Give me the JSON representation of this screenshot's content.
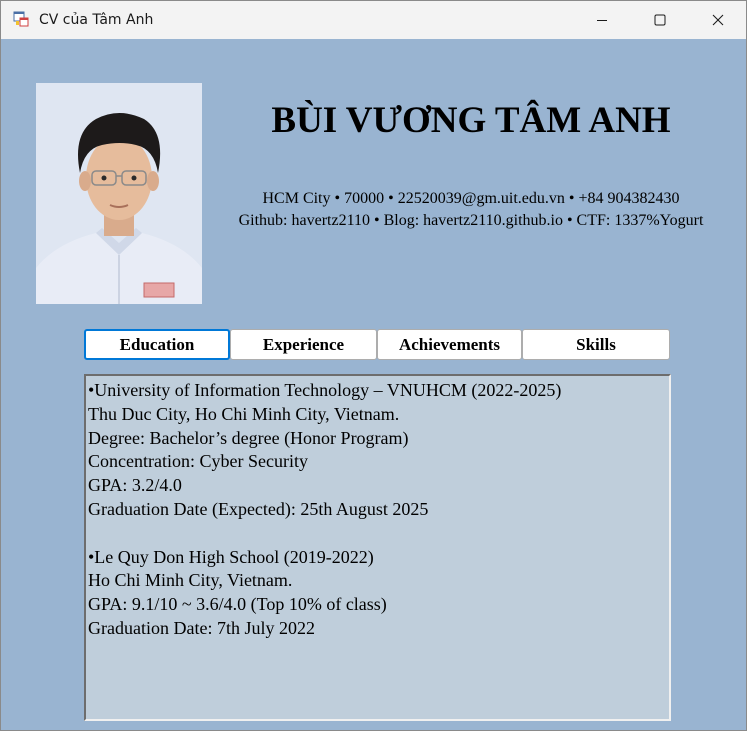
{
  "window": {
    "title": "CV của Tâm Anh"
  },
  "icons": {
    "app": "app-window-icon",
    "minimize": "minimize-icon",
    "maximize": "maximize-icon",
    "close": "close-icon"
  },
  "profile": {
    "name": "BÙI VƯƠNG TÂM ANH",
    "contact_line1": "HCM City • 70000 • 22520039@gm.uit.edu.vn • +84 904382430",
    "contact_line2": "Github: havertz2110 • Blog: havertz2110.github.io • CTF: 1337%Yogurt"
  },
  "tabs": [
    {
      "label": "Education",
      "active": true
    },
    {
      "label": "Experience",
      "active": false
    },
    {
      "label": "Achievements",
      "active": false
    },
    {
      "label": "Skills",
      "active": false
    }
  ],
  "education": {
    "lines": [
      "•University of Information Technology – VNUHCM (2022-2025)",
      "Thu Duc City, Ho Chi Minh City, Vietnam.",
      "Degree: Bachelor’s degree (Honor Program)",
      "Concentration: Cyber Security",
      "GPA: 3.2/4.0",
      "Graduation Date (Expected): 25th August 2025",
      "",
      "•Le Quy Don High School (2019-2022)",
      "Ho Chi Minh City, Vietnam.",
      "GPA: 9.1/10 ~ 3.6/4.0 (Top 10% of class)",
      "Graduation Date: 7th July 2022"
    ]
  },
  "colors": {
    "form_background": "#99b4d1",
    "content_background": "#bfcedb",
    "active_tab_border": "#0078d7"
  }
}
